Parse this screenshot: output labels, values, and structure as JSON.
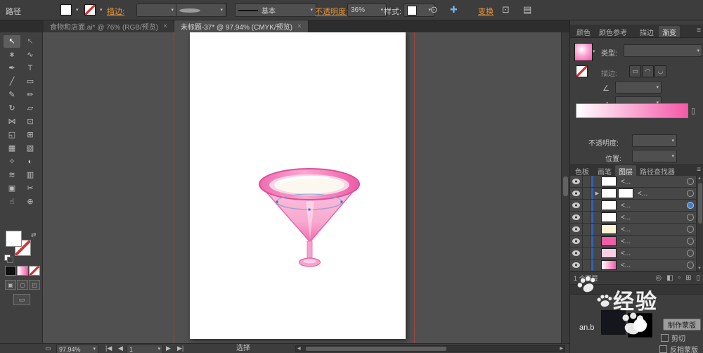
{
  "colors": {
    "accent_pink": "#f25ca8",
    "selection_blue": "#3f6cc8",
    "link_orange": "#e8963c",
    "guide_red": "#9a4a42"
  },
  "icons": {
    "chevron_down": "▾",
    "close": "×",
    "menu": "≡",
    "target": "⊙",
    "effects": "✚",
    "panel1": "⊡",
    "panel2": "▤",
    "doc": "▭",
    "nav_first": "|◀",
    "nav_prev": "◀",
    "nav_next": "▶",
    "nav_last": "▶|",
    "scroll_left": "◀",
    "scroll_right": "▶",
    "scroll_up": "▲",
    "scroll_down": "▼",
    "angle": "∠",
    "aspect": "⊿",
    "stroke_btn1": "▭",
    "stroke_btn2": "◠",
    "stroke_btn3": "◡",
    "trash": "▯",
    "locate": "◎",
    "clip_mask": "◧",
    "new_sublayer": "▫",
    "new_layer": "⊞",
    "delete": "▯",
    "expand": "▶",
    "swap": "⇄",
    "draw_normal": "▣",
    "draw_behind": "◻",
    "draw_inside": "◰",
    "screen_mode": "▭"
  },
  "control_bar": {
    "object_label": "路径",
    "stroke_link": "描边:",
    "brush_value": "基本",
    "opacity_link": "不透明度:",
    "opacity_value": "36%",
    "style_label": "样式:",
    "transform_link": "变换"
  },
  "document_tabs": [
    {
      "label": "食物和店面.ai* @ 76% (RGB/预览)",
      "close": "×"
    },
    {
      "label": "未标题-37* @ 97.94% (CMYK/预览)",
      "close": "×"
    }
  ],
  "tools": [
    {
      "name": "selection",
      "glyph": "↖"
    },
    {
      "name": "direct-selection",
      "glyph": "↖"
    },
    {
      "name": "magic-wand",
      "glyph": "∗"
    },
    {
      "name": "lasso",
      "glyph": "∿"
    },
    {
      "name": "pen",
      "glyph": "✒"
    },
    {
      "name": "type",
      "glyph": "T"
    },
    {
      "name": "line-segment",
      "glyph": "╱"
    },
    {
      "name": "rectangle",
      "glyph": "▭"
    },
    {
      "name": "paintbrush",
      "glyph": "✎"
    },
    {
      "name": "pencil",
      "glyph": "✏"
    },
    {
      "name": "rotate",
      "glyph": "↻"
    },
    {
      "name": "scale",
      "glyph": "▱"
    },
    {
      "name": "width",
      "glyph": "⋈"
    },
    {
      "name": "free-transform",
      "glyph": "⊡"
    },
    {
      "name": "shape-builder",
      "glyph": "◱"
    },
    {
      "name": "perspective-grid",
      "glyph": "⊞"
    },
    {
      "name": "mesh",
      "glyph": "▦"
    },
    {
      "name": "gradient",
      "glyph": "▧"
    },
    {
      "name": "eyedropper",
      "glyph": "✧"
    },
    {
      "name": "blend",
      "glyph": "◐"
    },
    {
      "name": "symbol-sprayer",
      "glyph": "≋"
    },
    {
      "name": "column-graph",
      "glyph": "▥"
    },
    {
      "name": "artboard",
      "glyph": "▣"
    },
    {
      "name": "slice",
      "glyph": "✂"
    },
    {
      "name": "hand",
      "glyph": "☝"
    },
    {
      "name": "zoom",
      "glyph": "⊕"
    }
  ],
  "toolbar": {
    "gradient_button_style": "background:linear-gradient(90deg,#ffffff,#f25ca8)"
  },
  "right_panel": {
    "tab_row1": [
      "颜色",
      "颜色参考",
      "描边",
      "渐变"
    ],
    "gradient": {
      "type_label": "类型:",
      "stroke_label": "描边:",
      "opacity_label": "不透明度:",
      "location_label": "位置:",
      "swatch_style": "background:radial-gradient(circle at 40% 35%, #ffffff 0%, #fba5d2 45%, #f558a8 100%)",
      "ramp_style": "background:linear-gradient(90deg,#ffffff,#f558a8)"
    },
    "tab_row2": [
      "色板",
      "画笔",
      "图层",
      "路径查找器"
    ],
    "layers": {
      "rows": [
        {
          "label": "<...",
          "thumb_style": "background:#ffffff"
        },
        {
          "label": "<...",
          "thumb_style": "background:#ffffff",
          "thumb2_style": "background:#ffffff"
        },
        {
          "label": "<...",
          "thumb_style": "background:#ffffff"
        },
        {
          "label": "<...",
          "thumb_style": "background:#ffffff"
        },
        {
          "label": "<...",
          "thumb_style": "background:#fdf4d5"
        },
        {
          "label": "<...",
          "thumb_style": "background:#f25ca8"
        },
        {
          "label": "<...",
          "thumb_style": "background:#f8cfe4"
        },
        {
          "label": "<...",
          "thumb_style": "background:linear-gradient(90deg,#ffffff,#f25ca8)"
        }
      ],
      "footer_text": "1 个图层"
    },
    "transparency": {
      "make_mask_label": "制作蒙版",
      "clip_label": "剪切",
      "invert_label": "反相蒙版"
    }
  },
  "status_bar": {
    "zoom": "97.94%",
    "artboard_number": "1",
    "tool_name": "选择"
  },
  "watermark": {
    "text_large": "经验",
    "text_small": "an.b"
  }
}
